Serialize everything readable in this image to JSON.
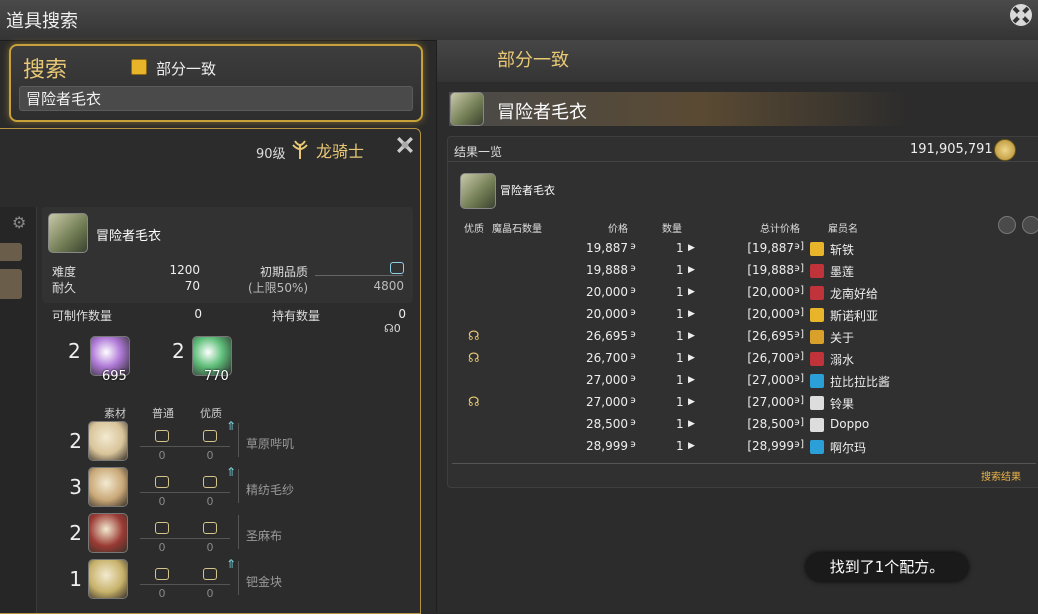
{
  "window": {
    "title": "道具搜索"
  },
  "search": {
    "label": "搜索",
    "partial_match_label": "部分一致",
    "query": "冒险者毛衣"
  },
  "crafter": {
    "level": "90级",
    "job": "龙骑士"
  },
  "recipe": {
    "name": "冒险者毛衣",
    "difficulty_label": "难度",
    "difficulty": "1200",
    "durability_label": "耐久",
    "durability": "70",
    "initial_quality_label": "初期品质",
    "max_label": "(上限50%)",
    "max_value": "4800",
    "craftable_label": "可制作数量",
    "craftable": "0",
    "owned_label": "持有数量",
    "owned": "0",
    "owned_hq": "0"
  },
  "crystals": [
    {
      "need": "2",
      "have": "695",
      "color": "#b07ad8"
    },
    {
      "need": "2",
      "have": "770",
      "color": "#5fbf7a"
    }
  ],
  "materials_header": {
    "material": "素材",
    "normal": "普通",
    "hq": "优质"
  },
  "materials": [
    {
      "qty": "2",
      "name": "草原哔叽",
      "nq": "0",
      "hq": "0",
      "has_hq": true
    },
    {
      "qty": "3",
      "name": "精纺毛纱",
      "nq": "0",
      "hq": "0",
      "has_hq": true
    },
    {
      "qty": "2",
      "name": "圣麻布",
      "nq": "0",
      "hq": "0",
      "has_hq": false
    },
    {
      "qty": "1",
      "name": "钯金块",
      "nq": "0",
      "hq": "0",
      "has_hq": true
    }
  ],
  "market": {
    "header": "部分一致",
    "selected_item": "冒险者毛衣",
    "results_title": "结果一览",
    "gil": "191,905,791",
    "item_name": "冒险者毛衣",
    "columns": {
      "quality": "优质",
      "materia": "魔晶石数量",
      "price": "价格",
      "quantity": "数量",
      "total": "总计价格",
      "retainer": "雇员名"
    },
    "rows": [
      {
        "hq": false,
        "price": "19,887",
        "qty": "1",
        "total": "[19,887",
        "retainer": "斩铁",
        "icon_color": "#e8b42a"
      },
      {
        "hq": false,
        "price": "19,888",
        "qty": "1",
        "total": "[19,888",
        "retainer": "墨莲",
        "icon_color": "#c0333a"
      },
      {
        "hq": false,
        "price": "20,000",
        "qty": "1",
        "total": "[20,000",
        "retainer": "龙南好给",
        "icon_color": "#c0333a"
      },
      {
        "hq": false,
        "price": "20,000",
        "qty": "1",
        "total": "[20,000",
        "retainer": "斯诺利亚",
        "icon_color": "#e8b42a"
      },
      {
        "hq": true,
        "price": "26,695",
        "qty": "1",
        "total": "[26,695",
        "retainer": "关于",
        "icon_color": "#d9a02a"
      },
      {
        "hq": true,
        "price": "26,700",
        "qty": "1",
        "total": "[26,700",
        "retainer": "溺水",
        "icon_color": "#c0333a"
      },
      {
        "hq": false,
        "price": "27,000",
        "qty": "1",
        "total": "[27,000",
        "retainer": "拉比拉比酱",
        "icon_color": "#2a9fd8"
      },
      {
        "hq": true,
        "price": "27,000",
        "qty": "1",
        "total": "[27,000",
        "retainer": "铃果",
        "icon_color": "#dddddd"
      },
      {
        "hq": false,
        "price": "28,500",
        "qty": "1",
        "total": "[28,500",
        "retainer": "Doppo",
        "icon_color": "#dddddd"
      },
      {
        "hq": false,
        "price": "28,999",
        "qty": "1",
        "total": "[28,999",
        "retainer": "啊尔玛",
        "icon_color": "#2a9fd8"
      }
    ],
    "search_results_link": "搜索结果"
  },
  "toast": "找到了1个配方。",
  "icons": {
    "close": "crossed-tools-icon",
    "gil": "gil-coin-icon",
    "job": "dragoon-job-icon",
    "settings": "gear-icon"
  }
}
